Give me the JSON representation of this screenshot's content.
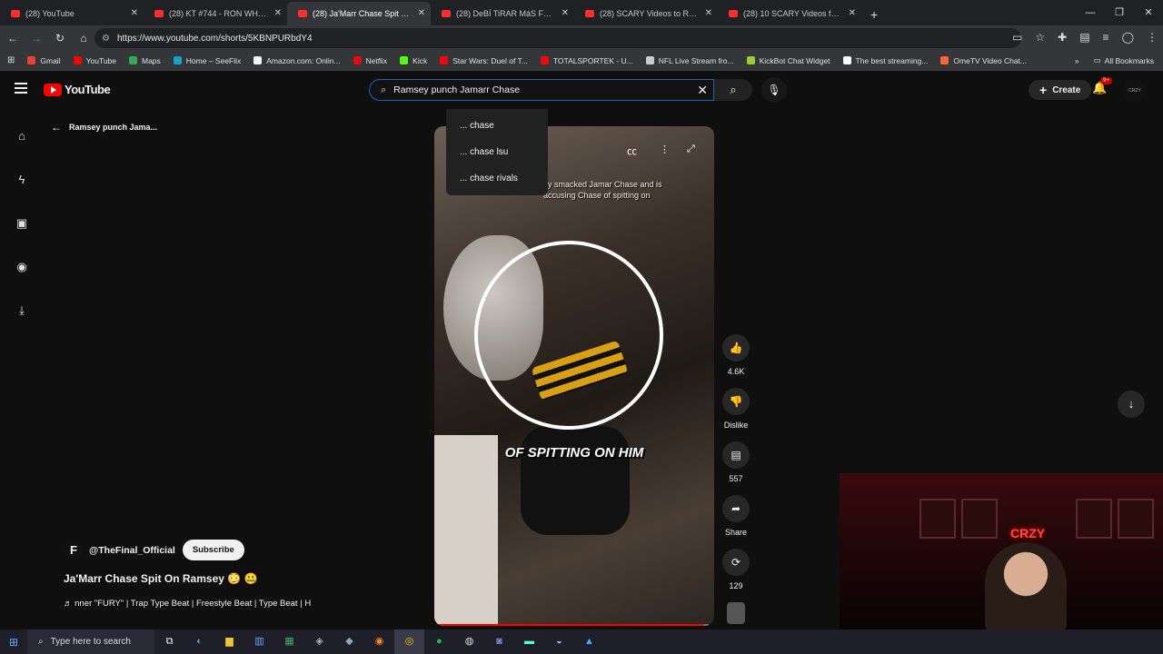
{
  "browser": {
    "tabs": [
      {
        "label": "(28) YouTube",
        "active": false
      },
      {
        "label": "(28) KT #744 - RON WHITE - Yo",
        "active": false
      },
      {
        "label": "(28) Ja'Marr Chase Spit On Ram",
        "active": true
      },
      {
        "label": "(28) DeBÍ TiRAR MáS FOToS | M",
        "active": false
      },
      {
        "label": "(28) SCARY Videos to RUIN You",
        "active": false
      },
      {
        "label": "(28) 10 SCARY Videos for NO S",
        "active": false
      }
    ],
    "url": "https://www.youtube.com/shorts/5KBNPURbdY4",
    "bookmarks": [
      {
        "label": "Gmail",
        "color": "#ea4335"
      },
      {
        "label": "YouTube",
        "color": "#ff0000"
      },
      {
        "label": "Maps",
        "color": "#34a853"
      },
      {
        "label": "Home – SeeFlix",
        "color": "#18a0c8"
      },
      {
        "label": "Amazon.com: Onlin...",
        "color": "#f5f5f5"
      },
      {
        "label": "Netflix",
        "color": "#e50914"
      },
      {
        "label": "Kick",
        "color": "#53fc18"
      },
      {
        "label": "Star Wars: Duel of T...",
        "color": "#ff0000"
      },
      {
        "label": "TOTALSPORTEK - U...",
        "color": "#ff0000"
      },
      {
        "label": "NFL Live Stream fro...",
        "color": "#cccccc"
      },
      {
        "label": "KickBot Chat Widget",
        "color": "#9acd32"
      },
      {
        "label": "The best streaming...",
        "color": "#ffffff"
      },
      {
        "label": "OmeTV Video Chat...",
        "color": "#ff6633"
      }
    ],
    "all_bookmarks": "All Bookmarks"
  },
  "yt": {
    "logo": "YouTube",
    "search_value": "Ramsey punch Jamarr Chase",
    "suggestions": [
      "... chase",
      "... chase lsu",
      "... chase rivals"
    ],
    "create": "Create",
    "notif_badge": "9+",
    "avatar": "CRZY"
  },
  "shorts": {
    "back_label": "Ramsey punch Jama...",
    "subtitle": "ay smacked Jamar Chase and is accusing Chase of spitting on",
    "caption": "OF SPITTING ON HIM",
    "like_count": "4.6K",
    "dislike_label": "Dislike",
    "comments": "557",
    "share_label": "Share",
    "remix_count": "129",
    "channel": "@TheFinal_Official",
    "channel_logo": "F",
    "subscribe": "Subscribe",
    "title": "Ja'Marr Chase Spit On Ramsey 😳 🤐",
    "music": "♬ nner    \"FURY\" | Trap Type Beat | Freestyle Beat | Type Beat | H",
    "progress": 0.98
  },
  "webcam": {
    "neon": "CRZY"
  },
  "taskbar": {
    "search_placeholder": "Type here to search"
  }
}
